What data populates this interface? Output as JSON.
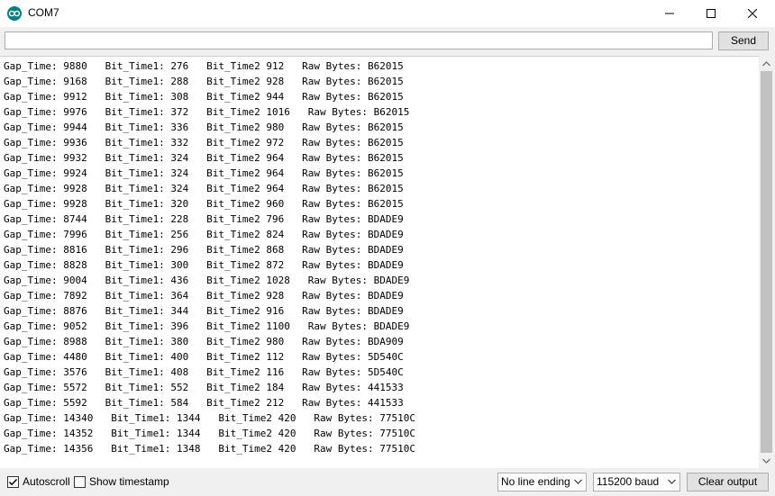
{
  "window": {
    "title": "COM7",
    "icon": "arduino-logo-icon",
    "controls": [
      "minimize-icon",
      "maximize-icon",
      "close-icon"
    ]
  },
  "send_bar": {
    "input_value": "",
    "send_label": "Send"
  },
  "output": {
    "lines": [
      "Gap_Time: 9880   Bit_Time1: 276   Bit_Time2 912   Raw Bytes: B62015",
      "Gap_Time: 9168   Bit_Time1: 288   Bit_Time2 928   Raw Bytes: B62015",
      "Gap_Time: 9912   Bit_Time1: 308   Bit_Time2 944   Raw Bytes: B62015",
      "Gap_Time: 9976   Bit_Time1: 372   Bit_Time2 1016   Raw Bytes: B62015",
      "Gap_Time: 9944   Bit_Time1: 336   Bit_Time2 980   Raw Bytes: B62015",
      "Gap_Time: 9936   Bit_Time1: 332   Bit_Time2 972   Raw Bytes: B62015",
      "Gap_Time: 9932   Bit_Time1: 324   Bit_Time2 964   Raw Bytes: B62015",
      "Gap_Time: 9924   Bit_Time1: 324   Bit_Time2 964   Raw Bytes: B62015",
      "Gap_Time: 9928   Bit_Time1: 324   Bit_Time2 964   Raw Bytes: B62015",
      "Gap_Time: 9928   Bit_Time1: 320   Bit_Time2 960   Raw Bytes: B62015",
      "Gap_Time: 8744   Bit_Time1: 228   Bit_Time2 796   Raw Bytes: BDADE9",
      "Gap_Time: 7996   Bit_Time1: 256   Bit_Time2 824   Raw Bytes: BDADE9",
      "Gap_Time: 8816   Bit_Time1: 296   Bit_Time2 868   Raw Bytes: BDADE9",
      "Gap_Time: 8828   Bit_Time1: 300   Bit_Time2 872   Raw Bytes: BDADE9",
      "Gap_Time: 9004   Bit_Time1: 436   Bit_Time2 1028   Raw Bytes: BDADE9",
      "Gap_Time: 7892   Bit_Time1: 364   Bit_Time2 928   Raw Bytes: BDADE9",
      "Gap_Time: 8876   Bit_Time1: 344   Bit_Time2 916   Raw Bytes: BDADE9",
      "Gap_Time: 9052   Bit_Time1: 396   Bit_Time2 1100   Raw Bytes: BDADE9",
      "Gap_Time: 8988   Bit_Time1: 380   Bit_Time2 980   Raw Bytes: BDA909",
      "Gap_Time: 4480   Bit_Time1: 400   Bit_Time2 112   Raw Bytes: 5D540C",
      "Gap_Time: 3576   Bit_Time1: 408   Bit_Time2 116   Raw Bytes: 5D540C",
      "Gap_Time: 5572   Bit_Time1: 552   Bit_Time2 184   Raw Bytes: 441533",
      "Gap_Time: 5592   Bit_Time1: 584   Bit_Time2 212   Raw Bytes: 441533",
      "Gap_Time: 14340   Bit_Time1: 1344   Bit_Time2 420   Raw Bytes: 77510C",
      "Gap_Time: 14352   Bit_Time1: 1344   Bit_Time2 420   Raw Bytes: 77510C",
      "Gap_Time: 14356   Bit_Time1: 1348   Bit_Time2 420   Raw Bytes: 77510C"
    ]
  },
  "bottom_bar": {
    "autoscroll_label": "Autoscroll",
    "autoscroll_checked": true,
    "timestamp_label": "Show timestamp",
    "timestamp_checked": false,
    "line_ending": "No line ending",
    "baud_rate": "115200 baud",
    "clear_label": "Clear output"
  }
}
